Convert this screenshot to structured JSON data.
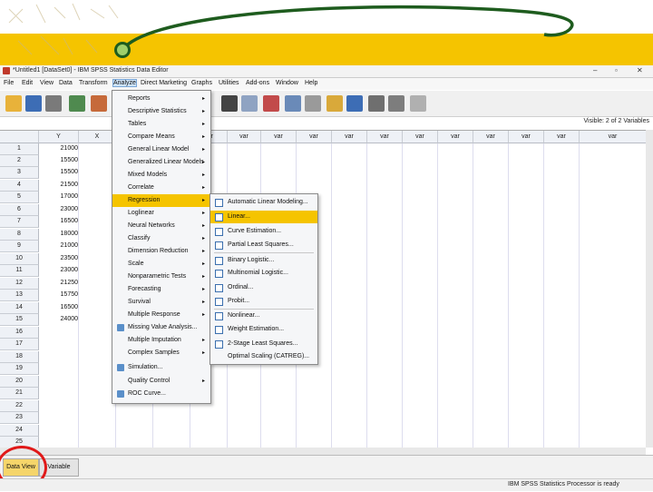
{
  "window": {
    "title": "*Untitled1 [DataSet0] - IBM SPSS Statistics Data Editor",
    "controls": [
      "–",
      "▫",
      "✕"
    ]
  },
  "menubar": [
    {
      "label": "File"
    },
    {
      "label": "Edit"
    },
    {
      "label": "View"
    },
    {
      "label": "Data"
    },
    {
      "label": "Transform"
    },
    {
      "label": "Analyze"
    },
    {
      "label": "Direct Marketing"
    },
    {
      "label": "Graphs"
    },
    {
      "label": "Utilities"
    },
    {
      "label": "Add-ons"
    },
    {
      "label": "Window"
    },
    {
      "label": "Help"
    }
  ],
  "variables_info": "Visible: 2 of 2 Variables",
  "grid": {
    "columns": [
      "Y",
      "X",
      "var",
      "var",
      "var",
      "var",
      "var",
      "var",
      "var",
      "var",
      "var",
      "var",
      "var",
      "var",
      "var",
      "var"
    ],
    "rows": [
      "1",
      "2",
      "3",
      "4",
      "5",
      "6",
      "7",
      "8",
      "9",
      "10",
      "11",
      "12",
      "13",
      "14",
      "15",
      "16",
      "17",
      "18",
      "19",
      "20",
      "21",
      "22",
      "23",
      "24",
      "25"
    ],
    "y_values": [
      "21000",
      "15500",
      "15500",
      "21500",
      "17000",
      "23000",
      "16500",
      "18000",
      "21000",
      "23500",
      "23000",
      "21250",
      "15750",
      "16500",
      "24000"
    ]
  },
  "analyze_menu": [
    {
      "label": "Reports",
      "arrow": "▸"
    },
    {
      "label": "Descriptive Statistics",
      "arrow": "▸"
    },
    {
      "label": "Tables",
      "arrow": "▸"
    },
    {
      "label": "Compare Means",
      "arrow": "▸"
    },
    {
      "label": "General Linear Model",
      "arrow": "▸"
    },
    {
      "label": "Generalized Linear Models",
      "arrow": "▸"
    },
    {
      "label": "Mixed Models",
      "arrow": "▸"
    },
    {
      "label": "Correlate",
      "arrow": "▸"
    },
    {
      "label": "Regression",
      "arrow": "▸"
    },
    {
      "label": "Loglinear",
      "arrow": "▸"
    },
    {
      "label": "Neural Networks",
      "arrow": "▸"
    },
    {
      "label": "Classify",
      "arrow": "▸"
    },
    {
      "label": "Dimension Reduction",
      "arrow": "▸"
    },
    {
      "label": "Scale",
      "arrow": "▸"
    },
    {
      "label": "Nonparametric Tests",
      "arrow": "▸"
    },
    {
      "label": "Forecasting",
      "arrow": "▸"
    },
    {
      "label": "Survival",
      "arrow": "▸"
    },
    {
      "label": "Multiple Response",
      "arrow": "▸"
    },
    {
      "label": "Missing Value Analysis...",
      "arrow": ""
    },
    {
      "label": "Multiple Imputation",
      "arrow": "▸"
    },
    {
      "label": "Complex Samples",
      "arrow": "▸"
    },
    {
      "label": "Simulation...",
      "arrow": ""
    },
    {
      "label": "Quality Control",
      "arrow": "▸"
    },
    {
      "label": "ROC Curve...",
      "arrow": ""
    }
  ],
  "regression_submenu": [
    {
      "label": "Automatic Linear Modeling..."
    },
    {
      "label": "Linear..."
    },
    {
      "label": "Curve Estimation..."
    },
    {
      "label": "Partial Least Squares..."
    },
    {
      "label": "Binary Logistic..."
    },
    {
      "label": "Multinomial Logistic..."
    },
    {
      "label": "Ordinal..."
    },
    {
      "label": "Probit..."
    },
    {
      "label": "Nonlinear..."
    },
    {
      "label": "Weight Estimation..."
    },
    {
      "label": "2-Stage Least Squares..."
    },
    {
      "label": "Optimal Scaling (CATREG)..."
    }
  ],
  "tabs": {
    "data_view": "Data View",
    "variable_view": "Variable View"
  },
  "status": "IBM SPSS Statistics Processor is ready",
  "colors": {
    "accent": "#f5c400",
    "highlight_circle": "#e01919",
    "swoosh": "#1e5c1e"
  }
}
